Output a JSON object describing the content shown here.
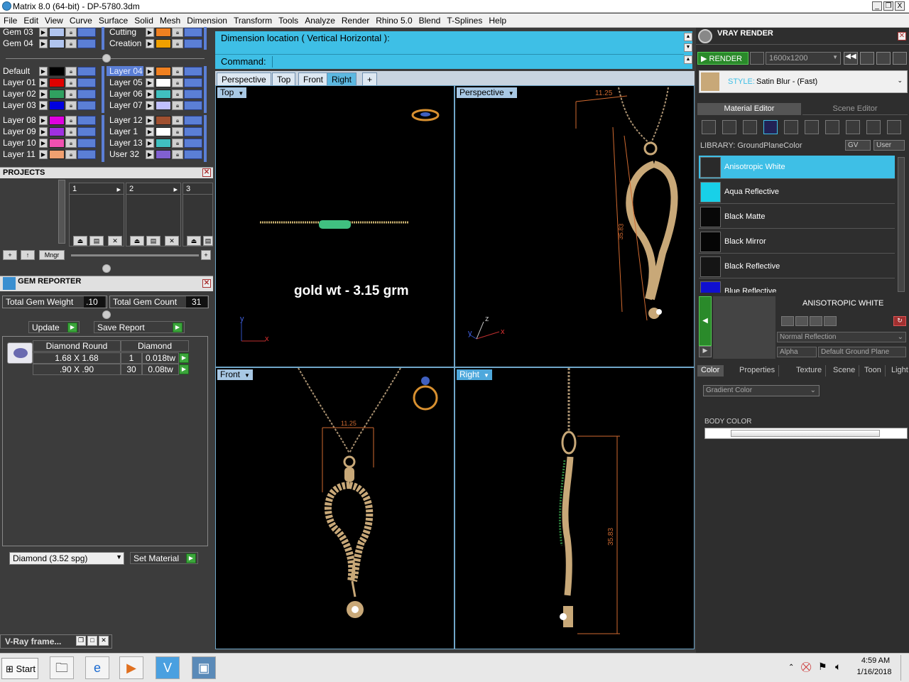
{
  "window": {
    "title": "Matrix 8.0 (64-bit) - DP-5780.3dm",
    "controls": [
      "_",
      "❐",
      "X"
    ]
  },
  "menu": [
    "File",
    "Edit",
    "View",
    "Curve",
    "Surface",
    "Solid",
    "Mesh",
    "Dimension",
    "Transform",
    "Tools",
    "Analyze",
    "Render",
    "Rhino 5.0",
    "Blend",
    "T-Splines",
    "Help"
  ],
  "layers": {
    "top_left": [
      {
        "name": "Gem 03",
        "color": "#b0c4ee"
      },
      {
        "name": "Gem 04",
        "color": "#b0c4ee"
      }
    ],
    "top_right": [
      {
        "name": "Cutting",
        "color": "#f08020"
      },
      {
        "name": "Creation",
        "color": "#f0a000"
      }
    ],
    "left": [
      {
        "name": "Default",
        "color": "#000000"
      },
      {
        "name": "Layer 01",
        "color": "#e00000"
      },
      {
        "name": "Layer 02",
        "color": "#30a060"
      },
      {
        "name": "Layer 03",
        "color": "#0000e0"
      },
      {
        "name": "Layer 08",
        "color": "#e000e0"
      },
      {
        "name": "Layer 09",
        "color": "#a030e0"
      },
      {
        "name": "Layer 10",
        "color": "#f050b0"
      },
      {
        "name": "Layer 11",
        "color": "#f0a070"
      }
    ],
    "right": [
      {
        "name": "Layer 04",
        "color": "#f08020"
      },
      {
        "name": "Layer 05",
        "color": "#ffffff"
      },
      {
        "name": "Layer 06",
        "color": "#40c0c0"
      },
      {
        "name": "Layer 07",
        "color": "#c0c0ff"
      },
      {
        "name": "Layer 12",
        "color": "#a05030"
      },
      {
        "name": "Layer 1",
        "color": "#ffffff"
      },
      {
        "name": "Layer 13",
        "color": "#40c0c0"
      },
      {
        "name": "User 32",
        "color": "#8060d0"
      }
    ]
  },
  "projects": {
    "title": "PROJECTS",
    "slots": [
      "1",
      "2",
      "3"
    ],
    "mngr": "Mngr"
  },
  "gem_reporter": {
    "title": "GEM REPORTER",
    "total_weight_label": "Total Gem Weight",
    "total_weight": ".10",
    "total_count_label": "Total Gem Count",
    "total_count": "31",
    "update": "Update",
    "save_report": "Save Report",
    "col1": "Diamond Round",
    "col2": "Diamond",
    "rows": [
      {
        "size": "1.68 X 1.68",
        "count": "1",
        "weight": "0.018tw"
      },
      {
        "size": ".90 X .90",
        "count": "30",
        "weight": "0.08tw"
      }
    ],
    "material": "Diamond    (3.52 spg)",
    "set_material": "Set Material"
  },
  "command": {
    "prompt": "Dimension location ( Vertical  Horizontal ):",
    "label": "Command:"
  },
  "viewport_tabs": [
    "Perspective",
    "Top",
    "Front",
    "Right",
    "+"
  ],
  "viewports": {
    "top": "Top",
    "perspective": "Perspective",
    "front": "Front",
    "right": "Right"
  },
  "annotation": "gold wt - 3.15 grm",
  "dims": {
    "persp_w": "11.25",
    "persp_h": "35.83",
    "front_w": "11.25",
    "right_h": "35.83"
  },
  "axes": {
    "x": "x",
    "y": "y",
    "z": "z"
  },
  "vray": {
    "title": "VRAY RENDER",
    "render": "RENDER",
    "resolution": "1600x1200",
    "style_label": "STYLE:",
    "style": "Satin Blur - (Fast)",
    "tabs": [
      "Material Editor",
      "Scene Editor"
    ],
    "library_label": "LIBRARY: GroundPlaneColor",
    "gv": "GV",
    "user": "User",
    "materials": [
      {
        "name": "Anisotropic White",
        "color": "#2a2a2a"
      },
      {
        "name": "Aqua Reflective",
        "color": "#18d0e8"
      },
      {
        "name": "Black Matte",
        "color": "#080808"
      },
      {
        "name": "Black Mirror",
        "color": "#050505"
      },
      {
        "name": "Black Reflective",
        "color": "#151515"
      },
      {
        "name": "Blue Reflective",
        "color": "#1010d0"
      }
    ],
    "selected_material": "ANISOTROPIC WHITE",
    "reflection": "Normal Reflection",
    "alpha": "Alpha",
    "ground": "Default Ground Plane",
    "prop_tabs": [
      "Color",
      "Properties",
      "Texture",
      "Scene",
      "Toon",
      "Light"
    ],
    "gradient": "Gradient Color",
    "body_color": "BODY COLOR"
  },
  "taskbar": {
    "start": "Start",
    "time": "4:59 AM",
    "date": "1/16/2018",
    "vray_frame": "V-Ray frame..."
  }
}
